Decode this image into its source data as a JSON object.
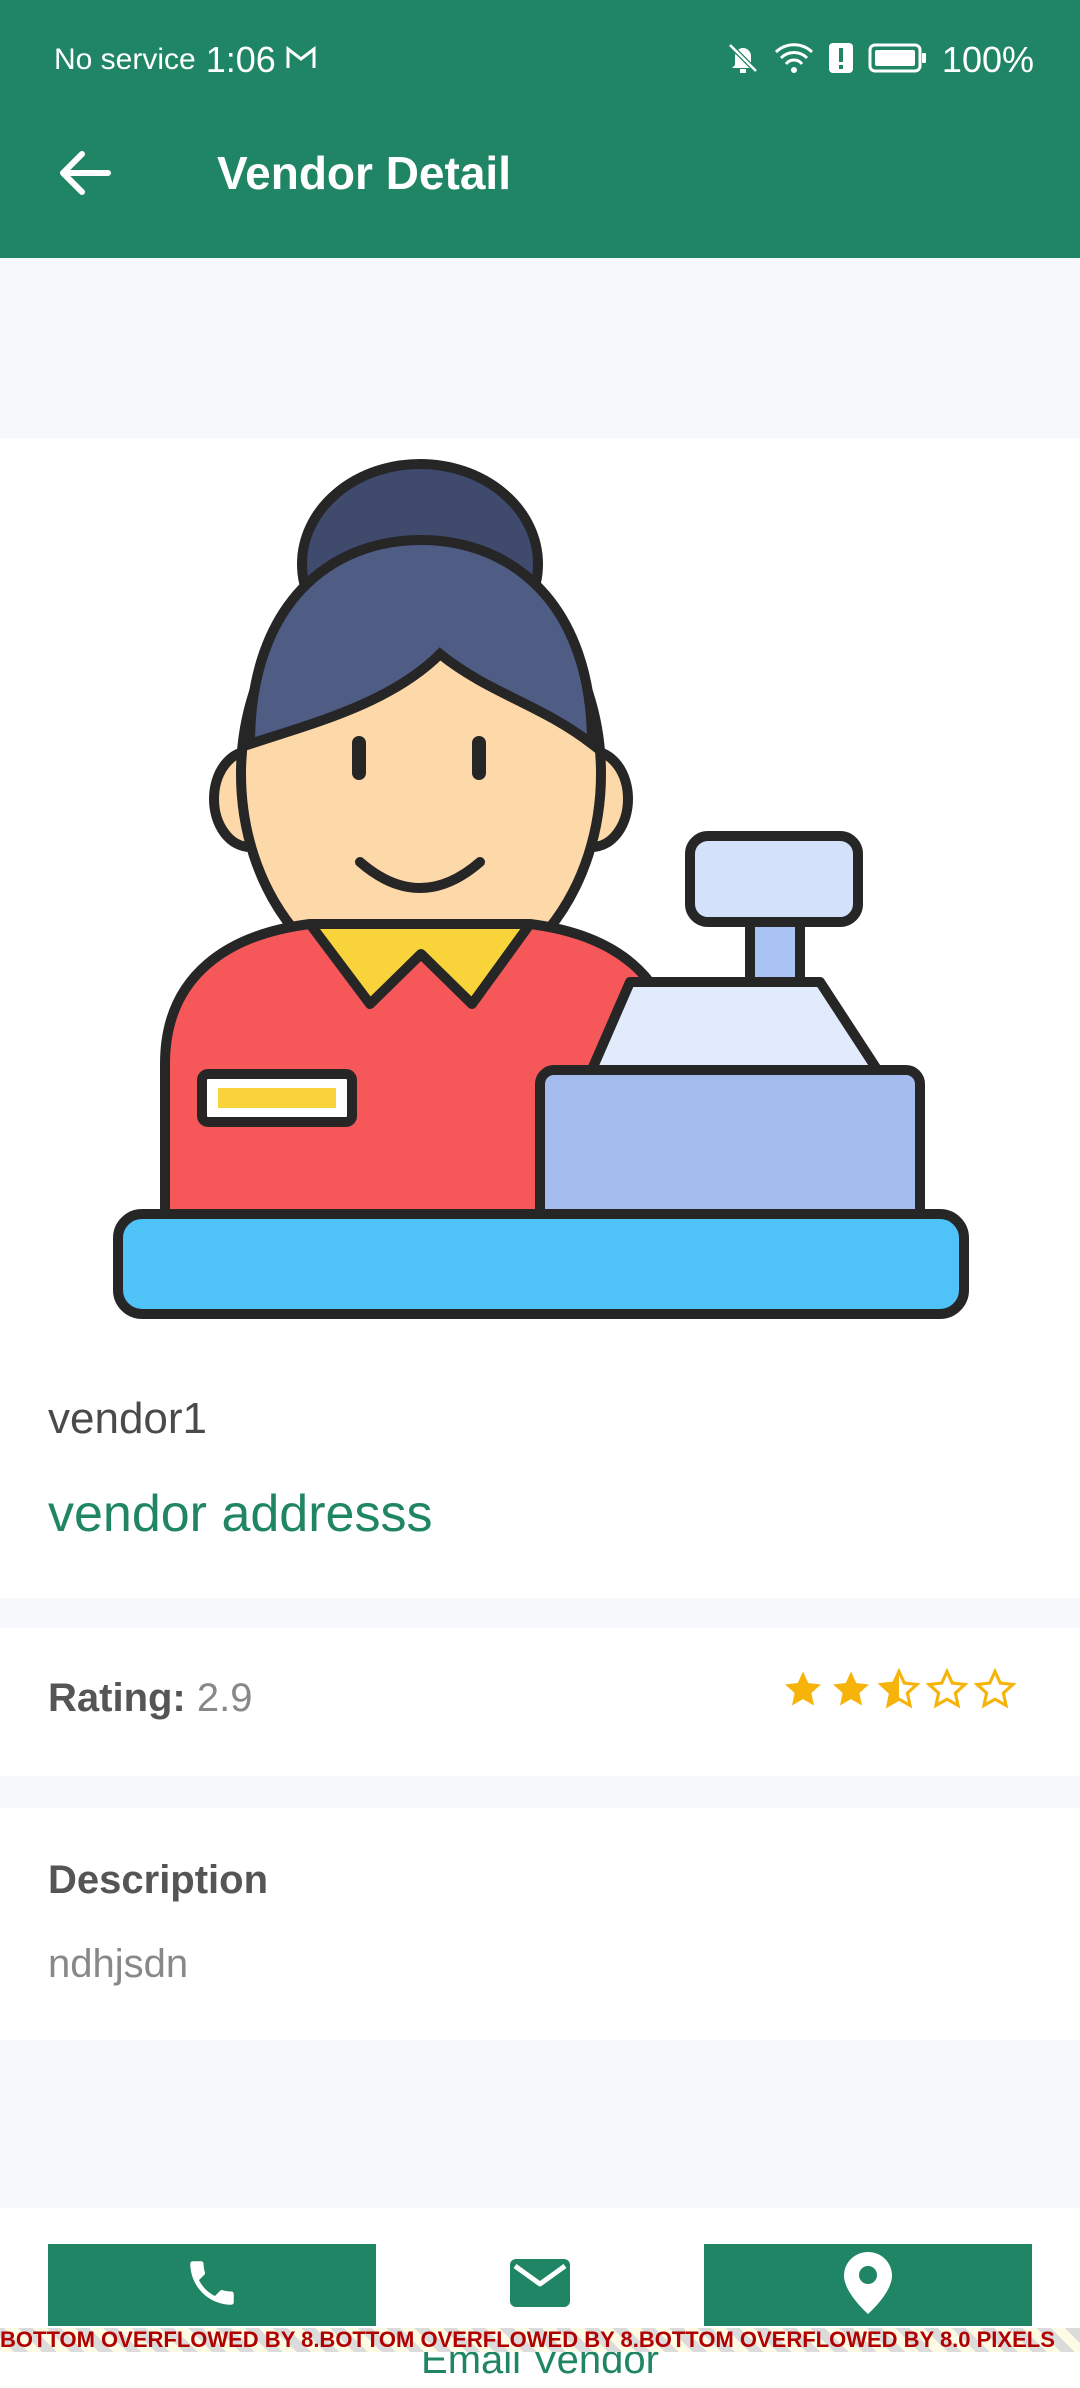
{
  "status_bar": {
    "carrier": "No service",
    "time": "1:06",
    "battery": "100%",
    "icons": [
      "gmail-icon",
      "bell-off-icon",
      "wifi-icon",
      "alert-icon",
      "battery-icon"
    ]
  },
  "app_bar": {
    "title": "Vendor Detail",
    "back_icon": "arrow-left-icon"
  },
  "vendor": {
    "name": "vendor1",
    "address": "vendor addresss"
  },
  "rating": {
    "label": "Rating:",
    "value": "2.9",
    "stars_filled": 2,
    "stars_half": 1,
    "stars_total": 5,
    "color": "#f6b40b"
  },
  "description": {
    "heading": "Description",
    "text": "ndhjsdn"
  },
  "actions": {
    "call_icon": "phone-icon",
    "email_icon": "mail-icon",
    "email_label": "Email Vendor",
    "location_icon": "location-pin-icon"
  },
  "overflow_text": "BOTTOM OVERFLOWED BY 8.BOTTOM OVERFLOWED BY 8.BOTTOM OVERFLOWED BY 8.0 PIXELS",
  "colors": {
    "primary": "#1f8565",
    "background": "#f7f8fc"
  }
}
